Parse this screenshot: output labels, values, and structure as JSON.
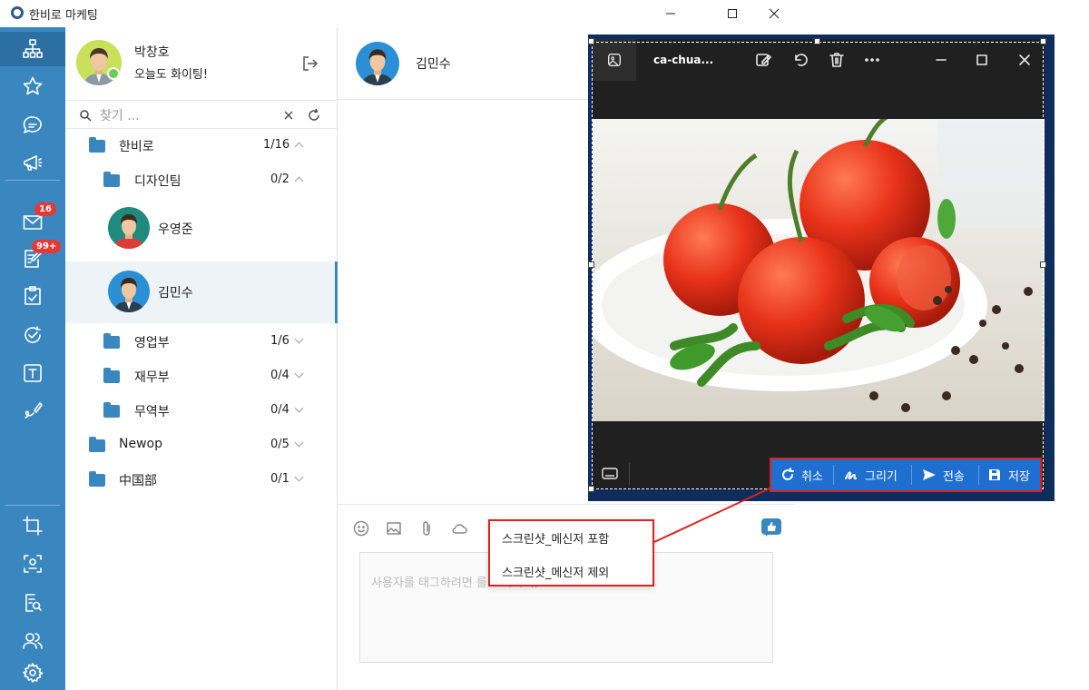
{
  "window": {
    "title": "한비로 마케팅"
  },
  "rail": {
    "badges": {
      "mail": "16",
      "notes": "99+"
    }
  },
  "profile": {
    "name": "박창호",
    "status": "오늘도 화이팅!"
  },
  "search": {
    "placeholder": "찾기 ..."
  },
  "tree": {
    "root": {
      "label": "한비로",
      "count": "1/16"
    },
    "design": {
      "label": "디자인팀",
      "count": "0/2"
    },
    "people": [
      "우영준",
      "김민수"
    ],
    "sales": {
      "label": "영업부",
      "count": "1/6"
    },
    "finance": {
      "label": "재무부",
      "count": "0/4"
    },
    "trade": {
      "label": "무역부",
      "count": "0/4"
    },
    "newop": {
      "label": "Newop",
      "count": "0/5"
    },
    "china": {
      "label": "中国部",
      "count": "0/1"
    }
  },
  "chat": {
    "partner": "김민수",
    "input_placeholder": "사용자를 태그하려면                                     를 조작하여, Tab..."
  },
  "context_menu": {
    "items": [
      "스크린샷_메신저 포함",
      "스크린샷_메신저 제외"
    ]
  },
  "viewer": {
    "file_title": "ca-chua...",
    "actions": {
      "cancel": "취소",
      "draw": "그리기",
      "send": "전송",
      "save": "저장"
    }
  },
  "colors": {
    "rail": "#3a87c0",
    "accent_red": "#e02020",
    "action_blue": "#1f6fd1"
  }
}
